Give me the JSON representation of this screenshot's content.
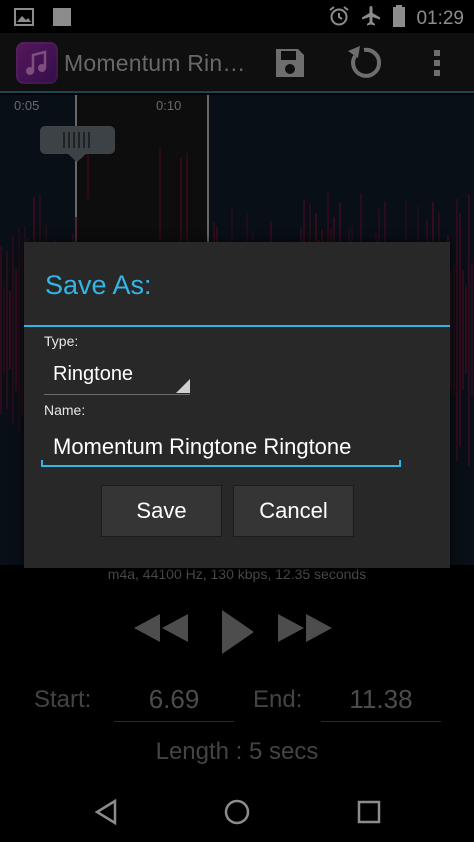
{
  "status_bar": {
    "left_icons": [
      "image-icon",
      "square-icon"
    ],
    "right_icons": [
      "alarm-icon",
      "airplane-icon",
      "battery-icon"
    ],
    "time": "01:29"
  },
  "action_bar": {
    "app_icon": "ringtone-app-icon",
    "title": "Momentum Rin…",
    "actions": [
      "save-icon",
      "reset-icon",
      "overflow-menu-icon"
    ]
  },
  "waveform": {
    "ticks": [
      "0:05",
      "0:10"
    ],
    "marker_icon": "grip-icon",
    "colors": {
      "background": "#0f1d28",
      "selection": "#181818",
      "wave": "#7a1238"
    }
  },
  "info": "m4a, 44100 Hz, 130 kbps, 12.35 seconds",
  "controls": [
    "rewind-icon",
    "play-icon",
    "fast-forward-icon"
  ],
  "range": {
    "start_label": "Start:",
    "start_value": "6.69",
    "end_label": "End:",
    "end_value": "11.38"
  },
  "length_text": "Length : 5 secs",
  "nav_bar": [
    "back-icon",
    "home-icon",
    "recents-icon"
  ],
  "dialog": {
    "title": "Save As:",
    "type_label": "Type:",
    "type_value": "Ringtone",
    "name_label": "Name:",
    "name_value": "Momentum Ringtone Ringtone",
    "save_label": "Save",
    "cancel_label": "Cancel",
    "accent_color": "#33b5e5"
  }
}
